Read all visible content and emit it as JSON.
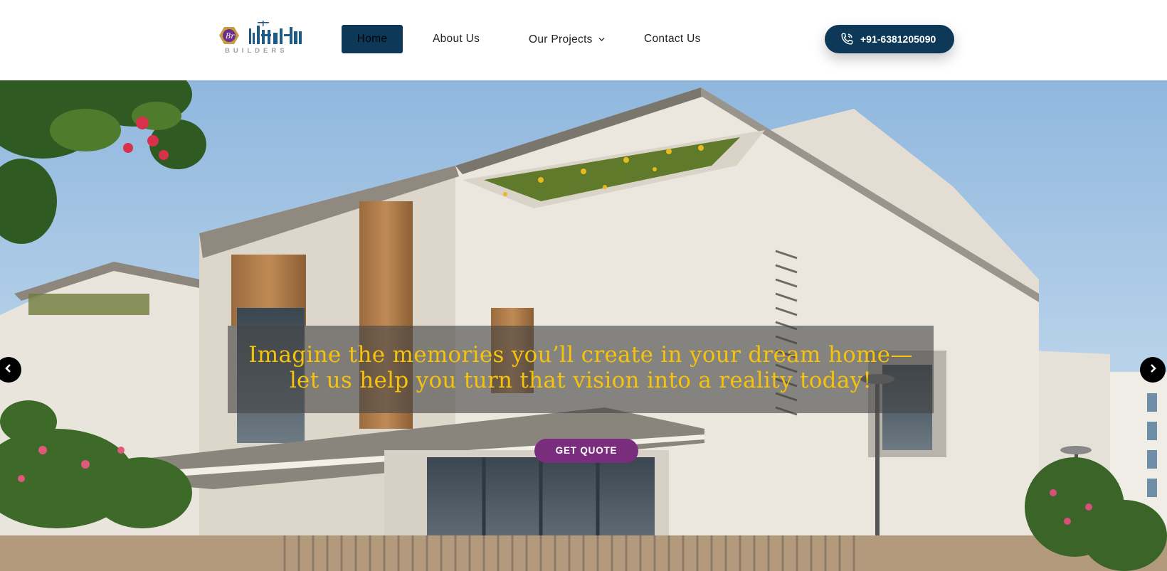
{
  "header": {
    "logo_text": "BUILDERS",
    "nav": [
      {
        "label": "Home",
        "active": true
      },
      {
        "label": "About Us"
      },
      {
        "label": "Our Projects",
        "has_dropdown": true
      },
      {
        "label": "Contact Us"
      }
    ],
    "phone": "+91-6381205090",
    "icons": {
      "phone": "phone-icon",
      "dropdown": "chevron-down-icon"
    }
  },
  "hero": {
    "caption_line1": "Imagine the memories you’ll create in your dream home—",
    "caption_line2": "let us help you turn that vision into a reality today!",
    "cta_label": "GET QUOTE",
    "icons": {
      "prev": "chevron-left-icon",
      "next": "chevron-right-icon"
    }
  },
  "colors": {
    "brand_navy": "#0d3858",
    "caption_gold": "#f5c20c",
    "cta_purple": "#7b2d7d"
  }
}
